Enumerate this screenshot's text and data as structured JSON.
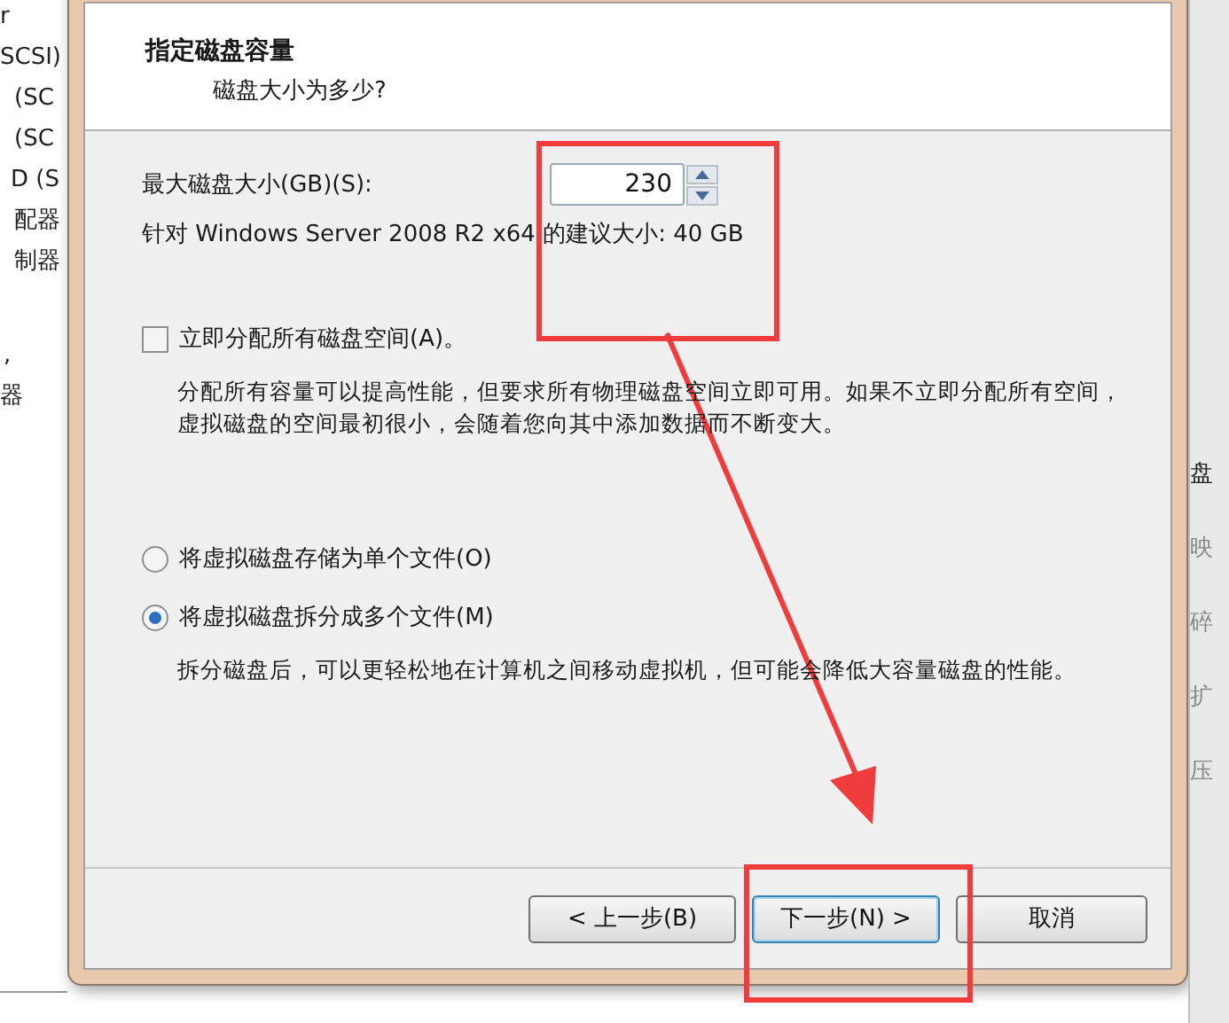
{
  "background_window": {
    "left_items": [
      "r",
      "SCSI)",
      "(SC",
      "(SC",
      "D (S",
      "配器",
      "制器",
      ",",
      "器"
    ],
    "right_items": [
      "盘",
      "映",
      "碎",
      "扩",
      "压"
    ]
  },
  "dialog": {
    "header": {
      "title": "指定磁盘容量",
      "subtitle": "磁盘大小为多少?"
    },
    "size_label": "最大磁盘大小(GB)(S):",
    "size_value": "230",
    "recommendation": "针对 Windows Server 2008 R2 x64 的建议大小: 40 GB",
    "allocate": {
      "label": "立即分配所有磁盘空间(A)。",
      "checked": false
    },
    "allocate_description": "分配所有容量可以提高性能，但要求所有物理磁盘空间立即可用。如果不立即分配所有空间，虚拟磁盘的空间最初很小，会随着您向其中添加数据而不断变大。",
    "storage_options": [
      {
        "label": "将虚拟磁盘存储为单个文件(O)",
        "selected": false
      },
      {
        "label": "将虚拟磁盘拆分成多个文件(M)",
        "selected": true
      }
    ],
    "split_description": "拆分磁盘后，可以更轻松地在计算机之间移动虚拟机，但可能会降低大容量磁盘的性能。",
    "buttons": [
      {
        "label": "< 上一步(B)",
        "focused": false
      },
      {
        "label": "下一步(N) >",
        "focused": true
      },
      {
        "label": "取消",
        "focused": false
      }
    ]
  }
}
